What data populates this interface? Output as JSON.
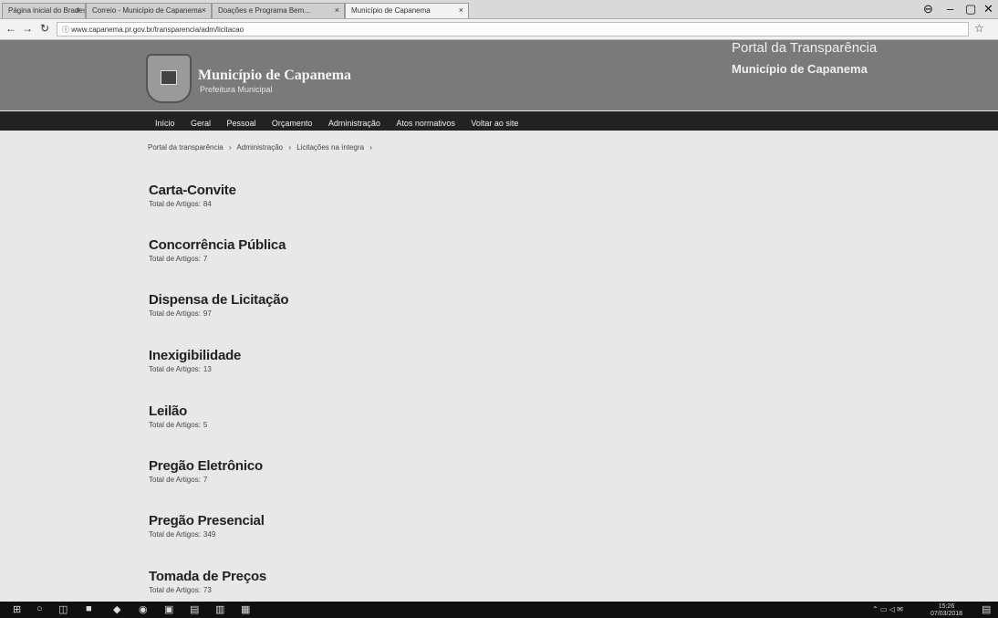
{
  "browser": {
    "tabs": [
      {
        "label": "Página inicial do Bradesco"
      },
      {
        "label": "Correio - Município de Capanema"
      },
      {
        "label": "Doações e Programa Bem..."
      },
      {
        "label": "Município de Capanema"
      }
    ],
    "url": "www.capanema.pr.gov.br/transparencia/adm/licitacao"
  },
  "header": {
    "site_title": "Município de Capanema",
    "site_subtitle": "Prefeitura Municipal",
    "portal_title": "Portal da Transparência",
    "portal_subtitle": "Município de Capanema"
  },
  "nav": {
    "items": [
      "Início",
      "Geral",
      "Pessoal",
      "Orçamento",
      "Administração",
      "Atos normativos",
      "Voltar ao site"
    ]
  },
  "breadcrumb": [
    "Portal da transparência",
    "›",
    "Administração",
    "›",
    "Licitações na íntegra",
    "›"
  ],
  "categories": [
    {
      "name": "Carta-Convite",
      "total_label": "Total de Artigos:",
      "total": "84"
    },
    {
      "name": "Concorrência Pública",
      "total_label": "Total de Artigos:",
      "total": "7"
    },
    {
      "name": "Dispensa de Licitação",
      "total_label": "Total de Artigos:",
      "total": "97"
    },
    {
      "name": "Inexigibilidade",
      "total_label": "Total de Artigos:",
      "total": "13"
    },
    {
      "name": "Leilão",
      "total_label": "Total de Artigos:",
      "total": "5"
    },
    {
      "name": "Pregão Eletrônico",
      "total_label": "Total de Artigos:",
      "total": "7"
    },
    {
      "name": "Pregão Presencial",
      "total_label": "Total de Artigos:",
      "total": "349"
    },
    {
      "name": "Tomada de Preços",
      "total_label": "Total de Artigos:",
      "total": "73"
    }
  ],
  "taskbar": {
    "time": "15:26",
    "date": "07/03/2018"
  }
}
